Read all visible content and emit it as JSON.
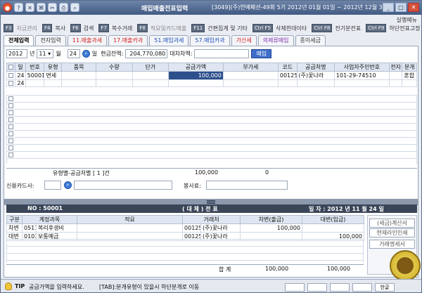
{
  "window": {
    "title": "매입매출전표입력",
    "company_info": "[3049](주)연예패션-49회 5기 2012년 01월 01일 ~ 2012년 12월 31일",
    "menu_link": "실행메뉴"
  },
  "toolbar": [
    {
      "key": "F3",
      "label": "자금관리",
      "dim": true
    },
    {
      "key": "F4",
      "label": "복사",
      "dim": false
    },
    {
      "key": "F6",
      "label": "검색",
      "dim": false
    },
    {
      "key": "F7",
      "label": "복수거래",
      "dim": false
    },
    {
      "key": "F8",
      "label": "적요및카드매출",
      "dim": true
    },
    {
      "key": "F11",
      "label": "간편집계 및 기타",
      "dim": false
    },
    {
      "key": "Ctrl F5",
      "label": "삭제한데이타",
      "dim": false
    },
    {
      "key": "Ctrl F8",
      "label": "전기분전표",
      "dim": false
    },
    {
      "key": "Ctrl F9",
      "label": "하단전표고정",
      "dim": false
    },
    {
      "key": "F12",
      "label": "조회",
      "dim": false
    }
  ],
  "tabs": [
    {
      "label": "전체입력",
      "style": "active"
    },
    {
      "label": "전자입력",
      "style": ""
    },
    {
      "label": "11.매출과세",
      "style": "red"
    },
    {
      "label": "17.매출카과",
      "style": "red"
    },
    {
      "label": "51.매입과세",
      "style": "blue"
    },
    {
      "label": "57.매입카과",
      "style": "blue"
    },
    {
      "label": "가산세",
      "style": "red"
    },
    {
      "label": "의제류매입",
      "style": "purple"
    },
    {
      "label": "종이세금",
      "style": ""
    }
  ],
  "date_bar": {
    "year": "2012",
    "year_unit": "년",
    "month": "11",
    "month_unit": "월",
    "day": "24",
    "day_unit": "일",
    "cash_label": "현금잔액:",
    "cash_value": "204,770,080",
    "balance_label": "대차차액:",
    "balance_value": "",
    "purchase_button": "매입"
  },
  "entry_grid": {
    "headers": [
      "일",
      "번호",
      "유형",
      "품목",
      "수량",
      "단가",
      "공급가액",
      "부가세",
      "코드",
      "공급처명",
      "사업자주민번호",
      "전자",
      "분개"
    ],
    "rows": [
      [
        "24",
        "50001",
        "면세",
        "",
        "",
        "",
        "100,000",
        "",
        "00125",
        "(주)꽃나라",
        "101-29-74510",
        "",
        "혼합"
      ],
      [
        "24",
        "",
        "",
        "",
        "",
        "",
        "",
        "",
        "",
        "",
        "",
        "",
        ""
      ]
    ],
    "summary_label": "유형별-공급처별 [ 1 ]건",
    "summary_supply": "100,000",
    "summary_vat": "0"
  },
  "card_row": {
    "card_label": "신용카드사:",
    "service_label": "봉사료:"
  },
  "journal": {
    "no_label": "NO : 50001",
    "title": "( 대 체 ) 전 표",
    "date_label": "일 자 : 2012 년 11 월 24 일",
    "headers": [
      "구분",
      "계정과목",
      "적요",
      "거래처",
      "차변(출금)",
      "대변(입금)"
    ],
    "rows": [
      [
        "차변",
        "0511",
        "복리후생비",
        "",
        "00125",
        "(주)꽃나라",
        "100,000",
        ""
      ],
      [
        "대변",
        "0103",
        "보통예금",
        "",
        "00125",
        "(주)꽃나라",
        "",
        "100,000"
      ]
    ],
    "total_label": "합 계",
    "total_debit": "100,000",
    "total_credit": "100,000"
  },
  "side_panel": {
    "btn1": "(세금)계산서",
    "btn2": "현재라인인쇄",
    "btn3": "거래명세서"
  },
  "status": {
    "tip_label": "TIP",
    "message": "공급가액을 입력하세요.",
    "hint": "[TAB]:분개유형이 있을시 하단분개로 이동",
    "ind1": "한글"
  }
}
